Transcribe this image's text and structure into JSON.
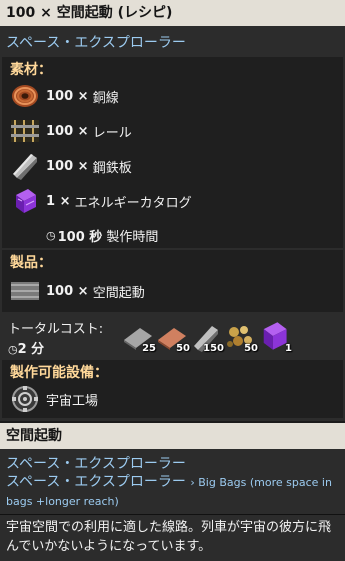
{
  "recipe": {
    "title": "100 × 空間起動 (レシピ)",
    "dlc_link": "スペース・エクスプローラー",
    "ingredients_header": "素材：",
    "ingredients": [
      {
        "amount": "100 ×",
        "name": "銅線",
        "icon": "copper-cable-icon"
      },
      {
        "amount": "100 ×",
        "name": "レール",
        "icon": "rail-icon"
      },
      {
        "amount": "100 ×",
        "name": "鋼鉄板",
        "icon": "steel-plate-icon"
      },
      {
        "amount": "1 ×",
        "name": "エネルギーカタログ",
        "icon": "energy-catalog-icon"
      }
    ],
    "time": {
      "value": "100 秒",
      "label": "製作時間"
    },
    "products_header": "製品：",
    "product": {
      "amount": "100 ×",
      "name": "空間起動",
      "icon": "space-rail-icon"
    },
    "total_cost_label": "トータルコスト:",
    "total_time": "2 分",
    "total_cost_items": [
      {
        "count": "25",
        "icon": "iron-plate-icon"
      },
      {
        "count": "50",
        "icon": "copper-plate-icon"
      },
      {
        "count": "150",
        "icon": "steel-plate-icon"
      },
      {
        "count": "50",
        "icon": "ore-chunks-icon"
      },
      {
        "count": "1",
        "icon": "energy-catalog-icon"
      }
    ],
    "made_in_header": "製作可能設備：",
    "made_in": {
      "name": "宇宙工場",
      "icon": "space-manufactory-icon"
    }
  },
  "item": {
    "title": "空間起動",
    "dlc_link_1": "スペース・エクスプローラー",
    "dlc_link_2": "スペース・エクスプローラー",
    "mod_chain": "› Big Bags (more space in bags +longer reach)",
    "description": "宇宙空間での利用に適した線路。列車が宇宙の彼方に飛んでいかないようになっています。"
  },
  "colors": {
    "header_text": "#ffd89a",
    "link_text": "#9ccbf0",
    "title_bar_bg": "#e3dfd6"
  }
}
